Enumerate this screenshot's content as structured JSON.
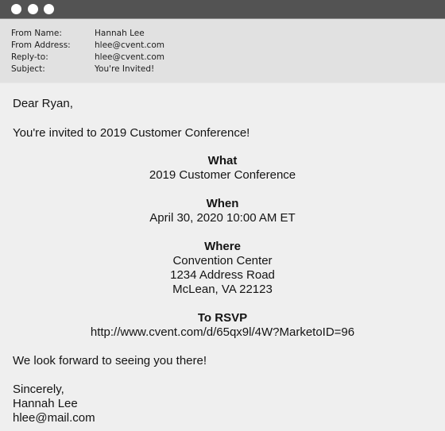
{
  "window": {
    "controls": [
      {
        "name": "close",
        "icon": "circle-dot-icon"
      },
      {
        "name": "minimize",
        "icon": "circle-dot-icon"
      },
      {
        "name": "maximize",
        "icon": "circle-dot-icon"
      }
    ]
  },
  "headers": [
    {
      "label": "From Name:",
      "value": "Hannah Lee"
    },
    {
      "label": "From Address:",
      "value": "hlee@cvent.com"
    },
    {
      "label": "Reply-to:",
      "value": "hlee@cvent.com"
    },
    {
      "label": "Subject:",
      "value": "You're Invited!"
    }
  ],
  "email": {
    "greeting": "Dear Ryan,",
    "intro": "You're invited to 2019 Customer Conference!",
    "what": {
      "heading": "What",
      "lines": [
        "2019 Customer Conference"
      ]
    },
    "when": {
      "heading": "When",
      "lines": [
        "April 30, 2020 10:00 AM ET"
      ]
    },
    "where": {
      "heading": "Where",
      "lines": [
        "Convention Center",
        "1234 Address Road",
        "McLean, VA 22123"
      ]
    },
    "rsvp": {
      "heading": "To RSVP",
      "link": "http://www.cvent.com/d/65qx9l/4W?MarketoID=96"
    },
    "closing_line": "We look forward to seeing you there!",
    "signoff": "Sincerely,",
    "signature_name": "Hannah Lee",
    "signature_email": "hlee@mail.com"
  },
  "colors": {
    "titlebar": "#535353",
    "header_bg": "#e1e1e1",
    "body_bg": "#efefef",
    "text": "#141414"
  }
}
